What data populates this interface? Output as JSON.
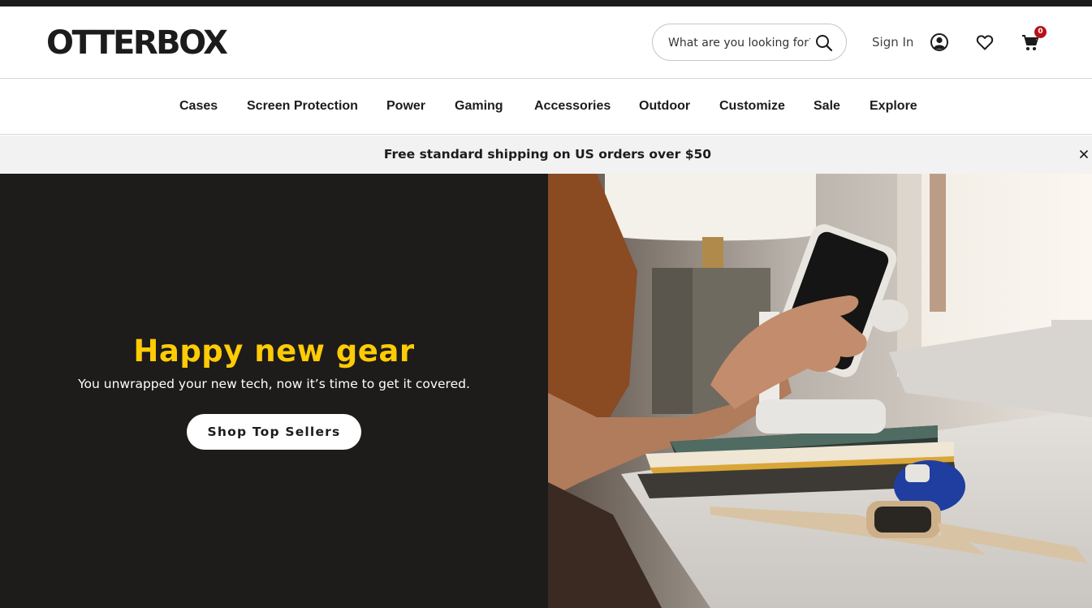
{
  "header": {
    "logo_text": "OTTERBOX",
    "search_placeholder": "What are you looking for?",
    "sign_in_label": "Sign In",
    "cart_count": "0"
  },
  "nav": {
    "items": [
      {
        "label": "Cases"
      },
      {
        "label": "Screen Protection"
      },
      {
        "label": "Power"
      },
      {
        "label": "Gaming"
      },
      {
        "label": "Accessories"
      },
      {
        "label": "Outdoor"
      },
      {
        "label": "Customize"
      },
      {
        "label": "Sale"
      },
      {
        "label": "Explore"
      }
    ]
  },
  "promo": {
    "text": "Free standard shipping on US orders over $50"
  },
  "hero": {
    "title": "Happy new gear",
    "subtitle": "You unwrapped your new tech, now it’s time to get it covered.",
    "cta_label": "Shop Top Sellers"
  },
  "colors": {
    "accent_yellow": "#ffcb05",
    "hero_dark": "#1e1b1b",
    "badge_red": "#b5121b",
    "promo_bg": "#f2f2f2"
  },
  "icons": [
    "search-icon",
    "account-icon",
    "heart-icon",
    "cart-icon",
    "close-icon"
  ]
}
